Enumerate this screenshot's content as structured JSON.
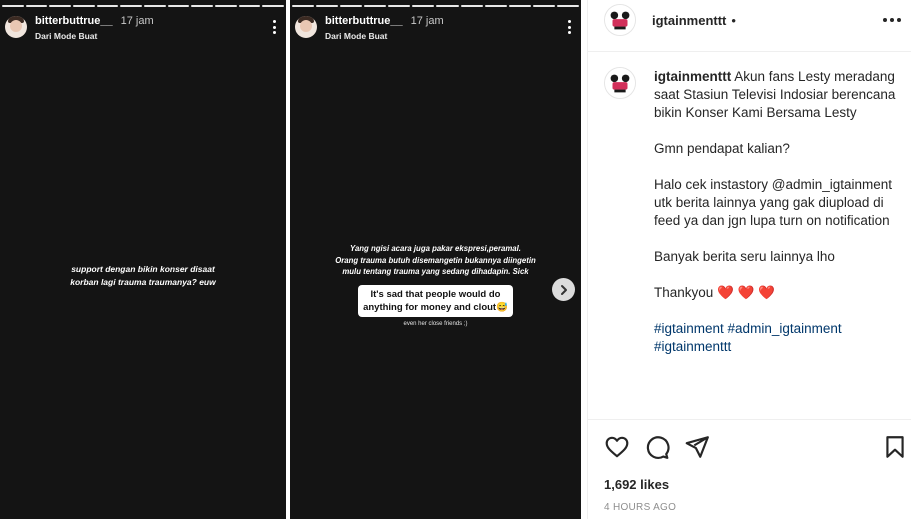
{
  "story1": {
    "username": "bitterbuttrue__",
    "time": "17 jam",
    "subtitle": "Dari Mode Buat",
    "text_line1": "support dengan bikin konser disaat",
    "text_line2": "korban lagi trauma traumanya? euw"
  },
  "story2": {
    "username": "bitterbuttrue__",
    "time": "17 jam",
    "subtitle": "Dari Mode Buat",
    "text_line1": "Yang ngisi acara juga pakar ekspresi,peramal.",
    "text_line2": "Orang trauma butuh disemangetin bukannya diingetin",
    "text_line3": "mulu tentang trauma yang sedang dihadapin. Sick",
    "quote_line1": "It's sad that people would do",
    "quote_line2": "anything for money and clout😅",
    "small_text": "even her close friends ;)"
  },
  "post": {
    "username": "igtainmenttt",
    "separator": "•",
    "follow_label": "",
    "caption": {
      "username": "igtainmenttt",
      "p1": "Akun fans Lesty meradang saat Stasiun Televisi Indosiar berencana bikin Konser Kami Bersama Lesty",
      "p2": "Gmn pendapat kalian?",
      "p3": "Halo cek instastory @admin_igtainment utk berita lainnya yang gak diupload di feed ya dan jgn lupa turn on notification",
      "p4": "Banyak berita seru lainnya lho",
      "p5_text": "Thankyou",
      "p5_hearts": "❤️ ❤️ ❤️",
      "tags_line1": "#igtainment #admin_igtainment",
      "tags_line2": "#igtainmenttt"
    },
    "likes": "1,692 likes",
    "time_ago": "4 HOURS AGO"
  },
  "icons": {
    "like": "heart-outline-icon",
    "comment": "comment-bubble-icon",
    "share": "paper-plane-icon",
    "save": "bookmark-icon",
    "next": "chevron-right-icon",
    "more": "three-dots-icon"
  }
}
